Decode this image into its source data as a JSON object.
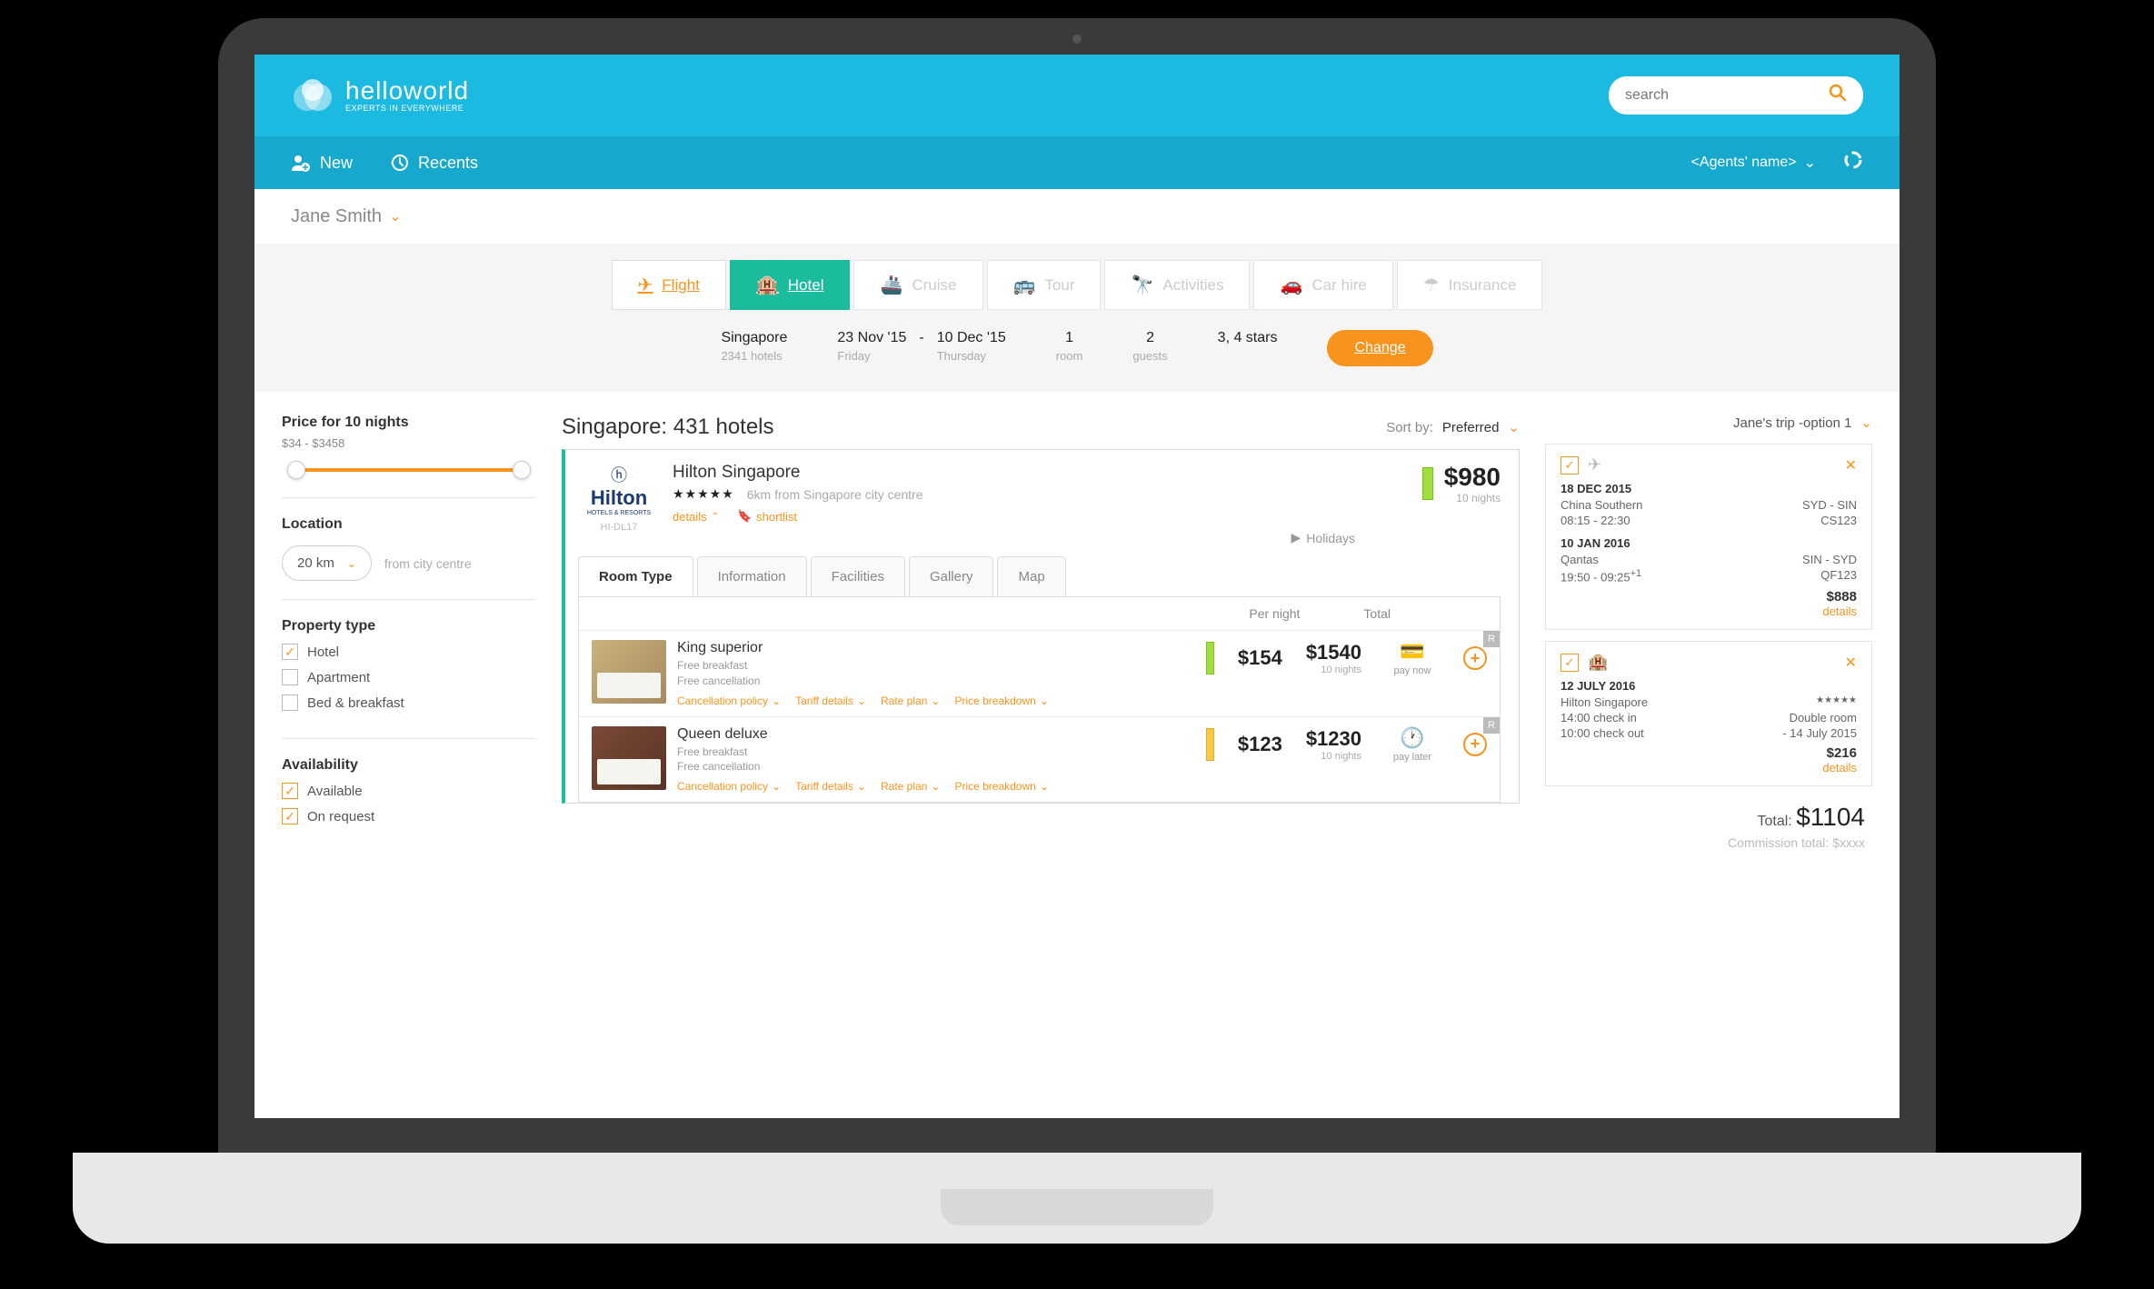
{
  "header": {
    "brand_main": "helloworld",
    "brand_sub": "EXPERTS IN EVERYWHERE",
    "search_placeholder": "search"
  },
  "subheader": {
    "new_label": "New",
    "recents_label": "Recents",
    "agent_label": "<Agents' name>"
  },
  "customer": {
    "name": "Jane Smith"
  },
  "tabs": {
    "flight": "Flight",
    "hotel": "Hotel",
    "cruise": "Cruise",
    "tour": "Tour",
    "activities": "Activities",
    "car": "Car hire",
    "insurance": "Insurance"
  },
  "criteria": {
    "dest": "Singapore",
    "dest_sub": "2341 hotels",
    "in_date": "23 Nov '15",
    "in_day": "Friday",
    "dash": "-",
    "out_date": "10 Dec '15",
    "out_day": "Thursday",
    "rooms": "1",
    "rooms_sub": "room",
    "guests": "2",
    "guests_sub": "guests",
    "stars": "3, 4 stars",
    "change": "Change"
  },
  "filters": {
    "price_title": "Price for 10 nights",
    "price_range": "$34 - $3458",
    "location_title": "Location",
    "loc_val": "20 km",
    "loc_from": "from city centre",
    "prop_title": "Property type",
    "prop_hotel": "Hotel",
    "prop_apt": "Apartment",
    "prop_bb": "Bed & breakfast",
    "avail_title": "Availability",
    "avail_1": "Available",
    "avail_2": "On request"
  },
  "results": {
    "title": "Singapore: 431 hotels",
    "sort_lbl": "Sort by:",
    "sort_val": "Preferred"
  },
  "hotel": {
    "brand": "Hilton",
    "brand_sub": "HOTELS & RESORTS",
    "code": "HI-DL17",
    "name": "Hilton Singapore",
    "stars": "★★★★★",
    "dist": "6km from Singapore city centre",
    "lnk_details": "details",
    "lnk_shortlist": "shortlist",
    "holidays": "Holidays",
    "price": "$980",
    "nights": "10 nights"
  },
  "room_tabs": {
    "t1": "Room Type",
    "t2": "Information",
    "t3": "Facilities",
    "t4": "Gallery",
    "t5": "Map"
  },
  "room_cols": {
    "per": "Per night",
    "tot": "Total"
  },
  "room1": {
    "name": "King superior",
    "inc1": "Free breakfast",
    "inc2": "Free cancellation",
    "per": "$154",
    "tot": "$1540",
    "nights": "10 nights",
    "pay": "pay now",
    "badge": "R"
  },
  "room2": {
    "name": "Queen deluxe",
    "inc1": "Free breakfast",
    "inc2": "Free cancellation",
    "per": "$123",
    "tot": "$1230",
    "nights": "10 nights",
    "pay": "pay later",
    "badge": "R"
  },
  "room_links": {
    "cancel": "Cancellation policy",
    "tariff": "Tariff details",
    "rate": "Rate plan",
    "break": "Price breakdown"
  },
  "trip": {
    "title": "Jane's trip -option 1",
    "flight": {
      "d1": "18 DEC 2015",
      "a1": "China Southern",
      "r1": "SYD - SIN",
      "t1": "08:15 - 22:30",
      "c1": "CS123",
      "d2": "10 JAN 2016",
      "a2": "Qantas",
      "r2": "SIN - SYD",
      "t2": "19:50 - 09:25",
      "sup": "+1",
      "c2": "QF123",
      "price": "$888",
      "details": "details"
    },
    "hotel": {
      "d1": "12 JULY 2016",
      "name": "Hilton Singapore",
      "stars": "★★★★★",
      "ci": "14:00 check in",
      "room": "Double room",
      "co": "10:00 check out",
      "range": "- 14 July 2015",
      "price": "$216",
      "details": "details"
    },
    "total_lbl": "Total:",
    "total_val": "$1104",
    "comm_lbl": "Commission total:",
    "comm_val": "$xxxx"
  }
}
